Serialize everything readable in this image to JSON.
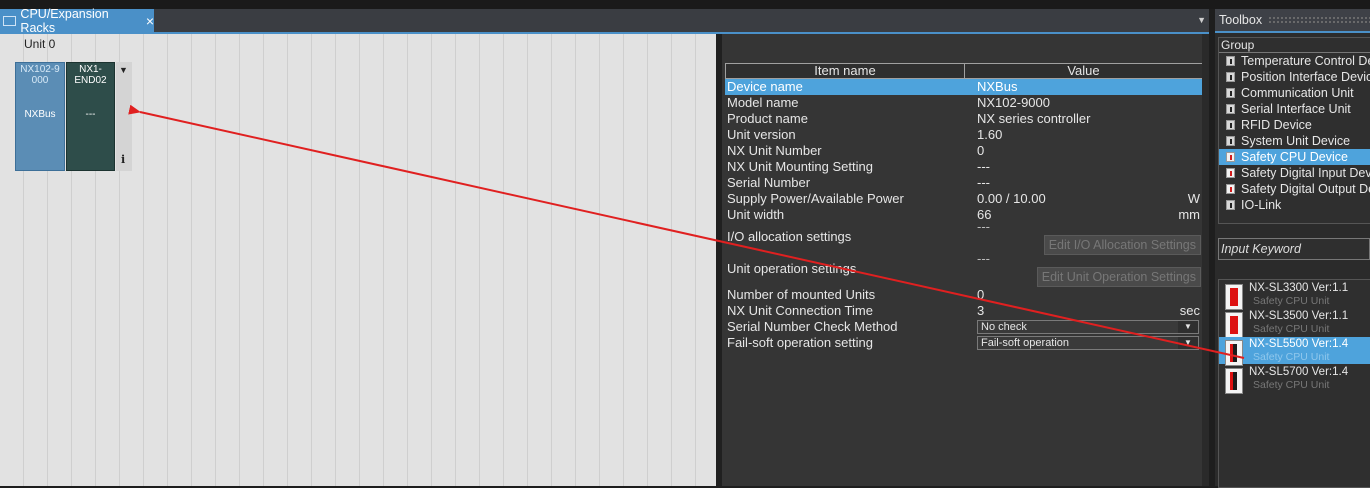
{
  "tab": {
    "title": "CPU/Expansion Racks",
    "close": "×",
    "dropdown": "▼"
  },
  "rack": {
    "unit_label": "Unit 0",
    "units": [
      {
        "model": "NX102-9000",
        "model_l1": "NX102-9",
        "model_l2": "000",
        "name": "NXBus"
      },
      {
        "model": "NX1-END02",
        "model_l1": "NX1-",
        "model_l2": "END02",
        "name": "---"
      }
    ],
    "strip_arrow": "▼",
    "info": "i"
  },
  "properties": {
    "header": {
      "item": "Item name",
      "value": "Value"
    },
    "rows": {
      "device_name": {
        "key": "Device name",
        "value": "NXBus"
      },
      "model_name": {
        "key": "Model name",
        "value": "NX102-9000"
      },
      "product_name": {
        "key": "Product name",
        "value": "NX series controller"
      },
      "unit_version": {
        "key": "Unit version",
        "value": "1.60"
      },
      "nx_unit_number": {
        "key": "NX Unit Number",
        "value": "0"
      },
      "mounting_setting": {
        "key": "NX Unit Mounting Setting",
        "value": "---"
      },
      "serial_number": {
        "key": "Serial Number",
        "value": "---"
      },
      "supply_power": {
        "key": "Supply Power/Available Power",
        "value": "0.00 / 10.00",
        "unit": "W"
      },
      "unit_width": {
        "key": "Unit width",
        "value": "66",
        "unit": "mm"
      },
      "io_allocation": {
        "key": "I/O allocation settings",
        "value": "---",
        "button": "Edit I/O Allocation Settings"
      },
      "unit_operation": {
        "key": "Unit operation settings",
        "value": "---",
        "button": "Edit Unit Operation Settings"
      },
      "mounted_units": {
        "key": "Number of mounted Units",
        "value": "0"
      },
      "connection_time": {
        "key": "NX Unit Connection Time",
        "value": "3",
        "unit": "sec"
      },
      "serial_check": {
        "key": "Serial Number Check Method",
        "value": "No check",
        "dd": "▼"
      },
      "failsoft": {
        "key": "Fail-soft operation setting",
        "value": "Fail-soft operation",
        "dd": "▼"
      }
    }
  },
  "toolbox": {
    "title": "Toolbox",
    "group_label": "Group",
    "groups": [
      "Temperature Control Device",
      "Position Interface Device",
      "Communication Unit",
      "Serial Interface Unit",
      "RFID Device",
      "System Unit Device",
      "Safety CPU Device",
      "Safety Digital Input Device",
      "Safety Digital Output Device",
      "IO-Link"
    ],
    "selected_group": "Safety CPU Device",
    "keyword_placeholder": "Input Keyword",
    "products": [
      {
        "name": "NX-SL3300 Ver:1.1",
        "sub": "Safety CPU Unit"
      },
      {
        "name": "NX-SL3500 Ver:1.1",
        "sub": "Safety CPU Unit"
      },
      {
        "name": "NX-SL5500 Ver:1.4",
        "sub": "Safety CPU Unit"
      },
      {
        "name": "NX-SL5700 Ver:1.4",
        "sub": "Safety CPU Unit"
      }
    ],
    "selected_product": "NX-SL5500 Ver:1.4"
  },
  "colors": {
    "accent": "#4a90c8",
    "selection": "#4ea3dc",
    "annotation": "#e02020"
  }
}
